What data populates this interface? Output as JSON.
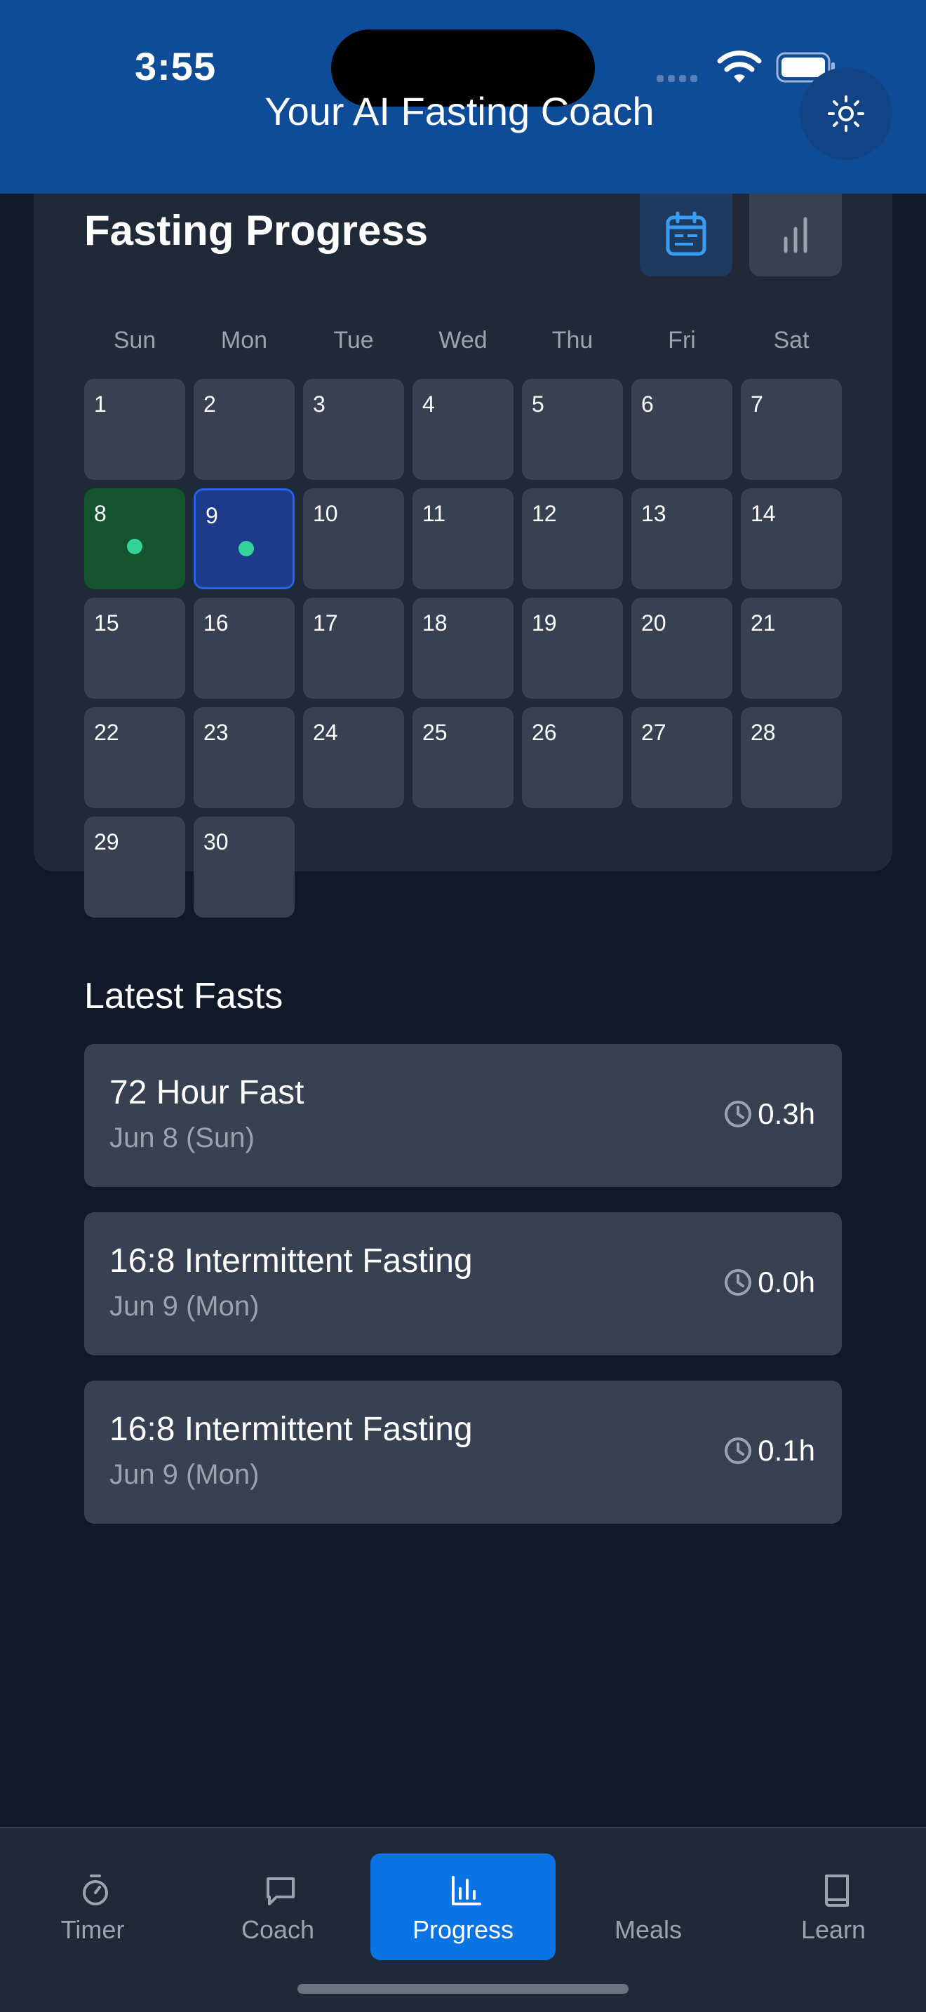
{
  "status_bar": {
    "time": "3:55"
  },
  "header": {
    "title": "Your AI Fasting Coach",
    "theme_icon": "sun-icon"
  },
  "progress": {
    "title": "Fasting Progress",
    "view_buttons": [
      {
        "name": "calendar-view",
        "icon": "calendar-icon",
        "active": true
      },
      {
        "name": "stats-view",
        "icon": "bar-chart-icon",
        "active": false
      }
    ],
    "weekdays": [
      "Sun",
      "Mon",
      "Tue",
      "Wed",
      "Thu",
      "Fri",
      "Sat"
    ],
    "days": [
      "1",
      "2",
      "3",
      "4",
      "5",
      "6",
      "7",
      "8",
      "9",
      "10",
      "11",
      "12",
      "13",
      "14",
      "15",
      "16",
      "17",
      "18",
      "19",
      "20",
      "21",
      "22",
      "23",
      "24",
      "25",
      "26",
      "27",
      "28",
      "29",
      "30"
    ],
    "completed_days": [
      "8"
    ],
    "today": "9",
    "days_with_fasts": [
      "8",
      "9"
    ]
  },
  "latest_fasts": {
    "title": "Latest Fasts",
    "items": [
      {
        "name": "72 Hour Fast",
        "date": "Jun 8 (Sun)",
        "duration": "0.3h"
      },
      {
        "name": "16:8 Intermittent Fasting",
        "date": "Jun 9 (Mon)",
        "duration": "0.0h"
      },
      {
        "name": "16:8 Intermittent Fasting",
        "date": "Jun 9 (Mon)",
        "duration": "0.1h"
      }
    ]
  },
  "nav": {
    "items": [
      {
        "label": "Timer",
        "icon": "stopwatch-icon"
      },
      {
        "label": "Coach",
        "icon": "chat-icon"
      },
      {
        "label": "Progress",
        "icon": "bar-chart-icon"
      },
      {
        "label": "Meals",
        "icon": "apple-icon"
      },
      {
        "label": "Learn",
        "icon": "book-icon"
      }
    ],
    "active": "Progress"
  },
  "colors": {
    "header": "#0f4c97",
    "background": "#111827",
    "card": "#1f2937",
    "accent": "#0b74e5",
    "success": "#34d399"
  }
}
